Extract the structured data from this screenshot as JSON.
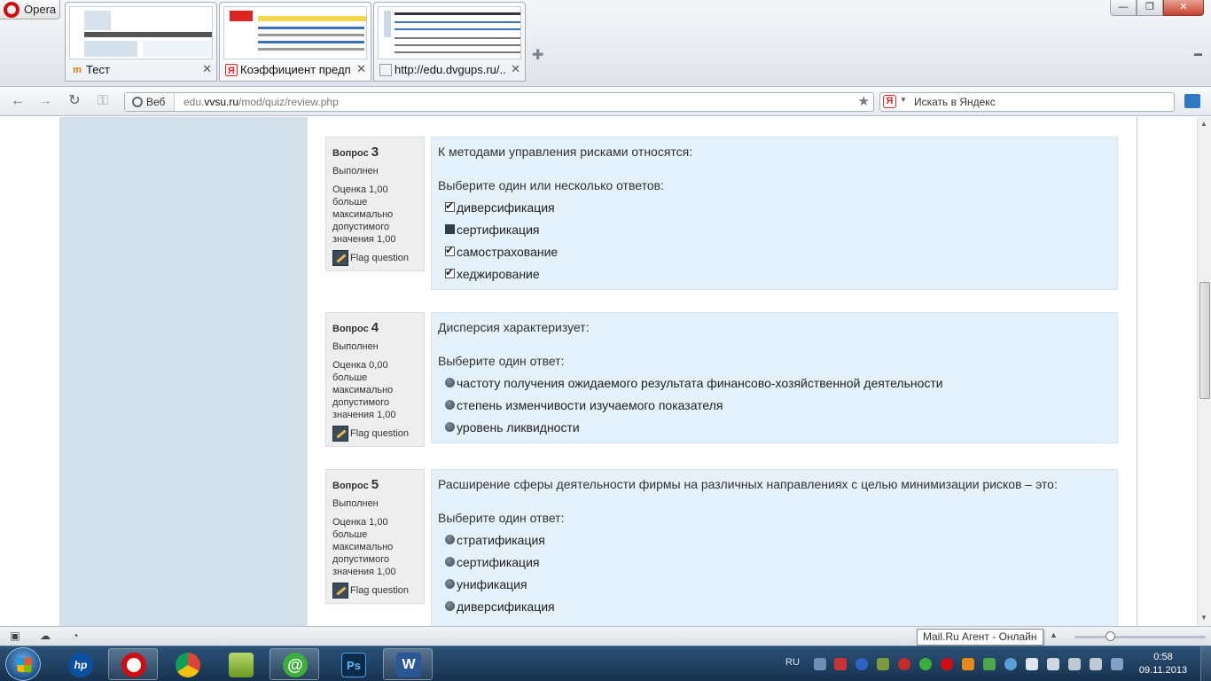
{
  "browser": {
    "menu_label": "Opera",
    "tabs": [
      {
        "title": "Тест",
        "icon": "moodle-icon"
      },
      {
        "title": "Коэффициент предп...",
        "icon": "yandex-icon"
      },
      {
        "title": "http://edu.dvgups.ru/...",
        "icon": "document-icon"
      }
    ],
    "address": {
      "badge": "Веб",
      "url_host": "edu.vvsu.ru",
      "url_prefix": "edu.",
      "url_domain": "vvsu.ru",
      "url_path": "/mod/quiz/review.php"
    },
    "search": {
      "placeholder": "Искать в Яндекс",
      "engine_letter": "Я"
    }
  },
  "quiz": {
    "flag_label": "Flag question",
    "questions": [
      {
        "label": "Вопрос",
        "number": "3",
        "state": "Выполнен",
        "grade_lines": [
          "Оценка 1,00",
          "больше",
          "максимально",
          "допустимого",
          "значения 1,00"
        ],
        "text": "К методами управления рисками относятся:",
        "prompt": "Выберите один или несколько ответов:",
        "type": "checkbox",
        "answers": [
          {
            "label": "диверсификация",
            "checked": true
          },
          {
            "label": "сертификация",
            "checked": false
          },
          {
            "label": "самострахование",
            "checked": true
          },
          {
            "label": "хеджирование",
            "checked": true
          }
        ]
      },
      {
        "label": "Вопрос",
        "number": "4",
        "state": "Выполнен",
        "grade_lines": [
          "Оценка 0,00",
          "больше",
          "максимально",
          "допустимого",
          "значения 1,00"
        ],
        "text": "Дисперсия характеризует:",
        "prompt": "Выберите один ответ:",
        "type": "radio",
        "answers": [
          {
            "label": "частоту получения ожидаемого результата финансово-хозяйственной деятельности"
          },
          {
            "label": "степень изменчивости изучаемого показателя"
          },
          {
            "label": "уровень ликвидности"
          }
        ]
      },
      {
        "label": "Вопрос",
        "number": "5",
        "state": "Выполнен",
        "grade_lines": [
          "Оценка 1,00",
          "больше",
          "максимально",
          "допустимого",
          "значения 1,00"
        ],
        "text": "Расширение сферы деятельности фирмы на различных направлениях с целью минимизации рисков – это:",
        "prompt": "Выберите один ответ:",
        "type": "radio",
        "answers": [
          {
            "label": "стратификация"
          },
          {
            "label": "сертификация"
          },
          {
            "label": "унификация"
          },
          {
            "label": "диверсификация"
          }
        ]
      }
    ]
  },
  "statusbar": {
    "tooltip": "Mail.Ru Агент - Онлайн"
  },
  "taskbar": {
    "apps": [
      {
        "name": "hp",
        "label": "hp"
      },
      {
        "name": "opera",
        "label": "O"
      },
      {
        "name": "chrome",
        "label": ""
      },
      {
        "name": "corel",
        "label": ""
      },
      {
        "name": "mail-agent",
        "label": "@"
      },
      {
        "name": "photoshop",
        "label": "Ps"
      },
      {
        "name": "word",
        "label": "W"
      }
    ],
    "language": "RU",
    "time": "0:58",
    "date": "09.11.2013"
  },
  "colors": {
    "left_column": "#d3e0ea",
    "question_content": "#e4f1fa",
    "question_info": "#eeeeee",
    "opera_red": "#d10d12"
  }
}
